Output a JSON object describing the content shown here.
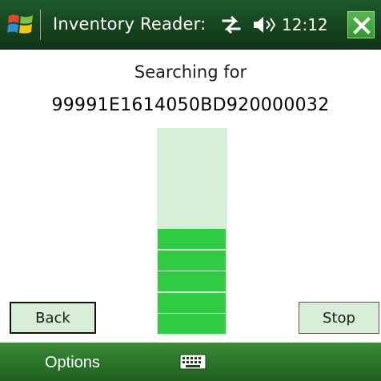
{
  "titlebar": {
    "title": "Inventory Reader:",
    "time": "12:12",
    "icons": [
      "windows-start-icon",
      "connectivity-icon",
      "volume-icon",
      "close-icon"
    ]
  },
  "main": {
    "searching_label": "Searching for",
    "tag_id": "99991E1614050BD920000032",
    "signal_meter": {
      "filled_segments": 5,
      "max_segments": 10,
      "fill_color": "#2fcc44",
      "track_color": "#d9eed8"
    }
  },
  "buttons": {
    "back_label": "Back",
    "stop_label": "Stop"
  },
  "softbar": {
    "left_label": "Options",
    "center_icon": "keyboard-icon"
  },
  "colors": {
    "titlebar": "#174821",
    "softbar": "#2e7a2c",
    "button_bg": "#d9eed8"
  }
}
